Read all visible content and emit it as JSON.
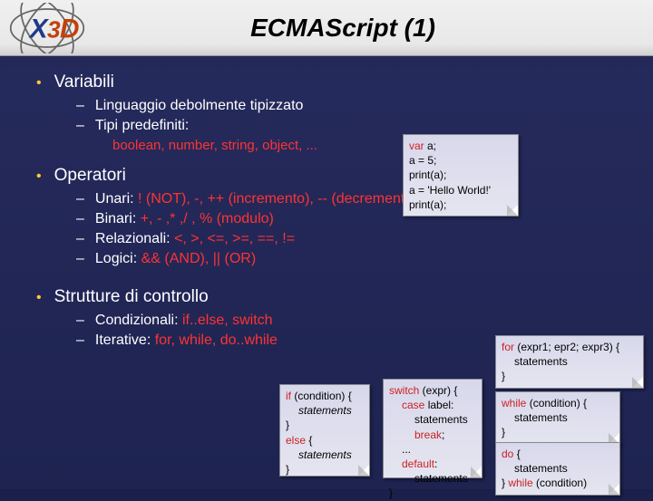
{
  "title": "ECMAScript (1)",
  "sections": {
    "variabili": {
      "heading": "Variabili",
      "items": [
        "Linguaggio debolmente tipizzato",
        "Tipi predefiniti:"
      ],
      "types": "boolean, number, string, object, ..."
    },
    "operatori": {
      "heading": "Operatori",
      "unari_label": "Unari: ",
      "unari_ops": "! (NOT), -, ++ (incremento), -- (decremento)",
      "binari_label": "Binari: ",
      "binari_ops": "+, - ,* ,/ , % (modulo)",
      "relazionali_label": "Relazionali: ",
      "relazionali_ops": "<, >, <=, >=, ==, !=",
      "logici_label": "Logici: ",
      "logici_ops": "&& (AND), || (OR)"
    },
    "strutture": {
      "heading": "Strutture di controllo",
      "cond_label": "Condizionali: ",
      "cond_kw": "if..else, switch",
      "iter_label": "Iterative: ",
      "iter_kw": "for, while, do..while"
    }
  },
  "code": {
    "box1": {
      "l1a": "var",
      "l1b": " a;",
      "l2": "a = 5;",
      "l3": "print(a);",
      "l4": "a = 'Hello World!'",
      "l5": "print(a);"
    },
    "box2": {
      "l1a": "if",
      "l1b": " (condition) {",
      "l2": "statements",
      "l3": "}",
      "l4a": "else",
      "l4b": " {",
      "l5": "statements",
      "l6": "}"
    },
    "box3": {
      "l1a": "switch",
      "l1b": " (expr) {",
      "l2a": "case",
      "l2b": " label:",
      "l3": "statements",
      "l4a": "break",
      "l4b": ";",
      "l5": "...",
      "l6a": "default",
      "l6b": ":",
      "l7": "statements",
      "l8": "}"
    },
    "box4": {
      "l1a": "for",
      "l1b": " (expr1; epr2; expr3) {",
      "l2": "statements",
      "l3": "}"
    },
    "box5": {
      "l1a": "while",
      "l1b": " (condition) {",
      "l2": "statements",
      "l3": "}"
    },
    "box6": {
      "l1a": "do",
      "l1b": " {",
      "l2": "statements",
      "l3a": "} ",
      "l3b": "while",
      "l3c": " (condition)"
    }
  }
}
